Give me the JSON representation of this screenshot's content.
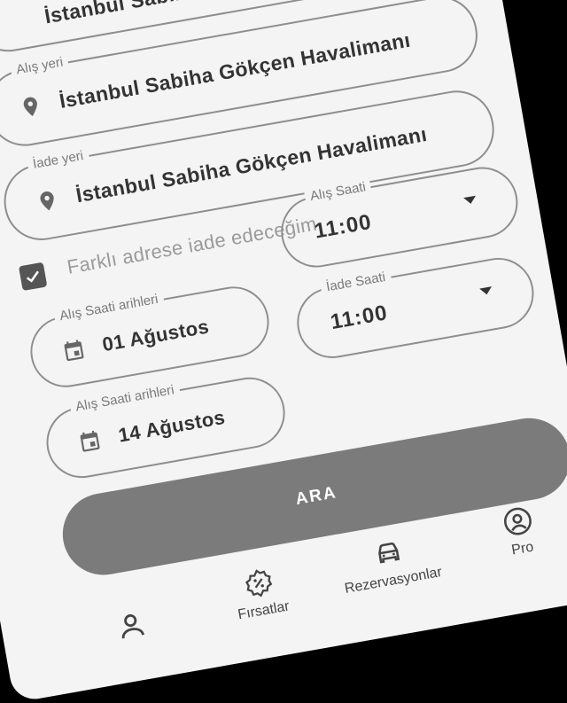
{
  "top_partial": {
    "value": "İstanbul Sabiha Gökçen Havalimanı"
  },
  "pickup": {
    "legend": "Alış yeri",
    "value": "İstanbul Sabiha Gökçen Havalimanı"
  },
  "dropoff": {
    "legend": "İade yeri",
    "value": "İstanbul Sabiha Gökçen Havalimanı"
  },
  "different_address": {
    "checked": true,
    "label": "Farklı adrese iade edeceğim"
  },
  "pickup_time": {
    "legend": "Alış Saati",
    "value": "11:00"
  },
  "return_time": {
    "legend": "İade Saati",
    "value": "11:00"
  },
  "pickup_date": {
    "legend": "Alış Saati arihleri",
    "value": "01 Ağustos"
  },
  "return_date": {
    "legend": "Alış Saati arihleri",
    "value": "14 Ağustos"
  },
  "search_button": {
    "label": "ARA"
  },
  "bottom_nav": {
    "items": [
      {
        "label": "",
        "icon": "person-icon"
      },
      {
        "label": "Fırsatlar",
        "icon": "discount-icon"
      },
      {
        "label": "Rezervasyonlar",
        "icon": "car-icon"
      },
      {
        "label": "Pro",
        "icon": "profile-icon"
      }
    ]
  }
}
